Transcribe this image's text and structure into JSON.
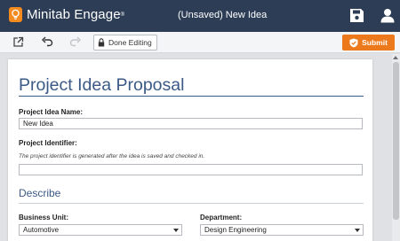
{
  "app": {
    "brand": "Minitab Engage",
    "trademark": "®",
    "doc_title": "(Unsaved) New Idea"
  },
  "toolbar": {
    "done_label": "Done Editing",
    "submit_label": "Submit"
  },
  "form": {
    "heading": "Project Idea Proposal",
    "idea_name_label": "Project Idea Name:",
    "idea_name_value": "New Idea",
    "identifier_label": "Project Identifier:",
    "identifier_hint": "The project identifier is generated after the idea is saved and checked in.",
    "identifier_value": "",
    "section_describe": "Describe",
    "business_unit_label": "Business Unit:",
    "business_unit_value": "Automotive",
    "department_label": "Department:",
    "department_value": "Design Engineering"
  },
  "colors": {
    "header_bg": "#2c3d55",
    "accent_orange": "#ec7a1c",
    "title_blue": "#3c5a86"
  }
}
